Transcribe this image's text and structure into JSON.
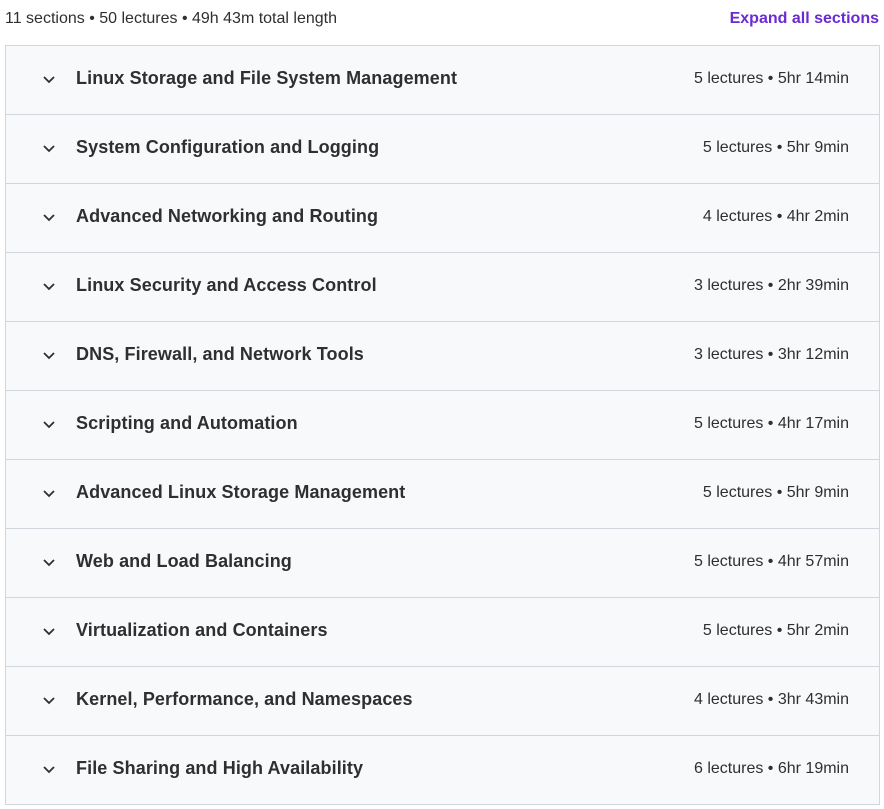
{
  "header": {
    "summary": "11 sections • 50 lectures • 49h 43m total length",
    "expand_label": "Expand all sections"
  },
  "colors": {
    "accent": "#6a2bd3",
    "row_bg": "#f7f9fa",
    "border": "#d1d7dc",
    "text": "#2d2f31"
  },
  "sections": [
    {
      "title": "Linux Storage and File System Management",
      "meta": "5 lectures • 5hr 14min",
      "icon": "chevron-down-icon"
    },
    {
      "title": "System Configuration and Logging",
      "meta": "5 lectures • 5hr 9min",
      "icon": "chevron-down-icon"
    },
    {
      "title": "Advanced Networking and Routing",
      "meta": "4 lectures • 4hr 2min",
      "icon": "chevron-down-icon"
    },
    {
      "title": "Linux Security and Access Control",
      "meta": "3 lectures • 2hr 39min",
      "icon": "chevron-down-icon"
    },
    {
      "title": "DNS, Firewall, and Network Tools",
      "meta": "3 lectures • 3hr 12min",
      "icon": "chevron-down-icon"
    },
    {
      "title": "Scripting and Automation",
      "meta": "5 lectures • 4hr 17min",
      "icon": "chevron-down-icon"
    },
    {
      "title": "Advanced Linux Storage Management",
      "meta": "5 lectures • 5hr 9min",
      "icon": "chevron-down-icon"
    },
    {
      "title": "Web and Load Balancing",
      "meta": "5 lectures • 4hr 57min",
      "icon": "chevron-down-icon"
    },
    {
      "title": "Virtualization and Containers",
      "meta": "5 lectures • 5hr 2min",
      "icon": "chevron-down-icon"
    },
    {
      "title": "Kernel, Performance, and Namespaces",
      "meta": "4 lectures • 3hr 43min",
      "icon": "chevron-down-icon"
    },
    {
      "title": "File Sharing and High Availability",
      "meta": "6 lectures • 6hr 19min",
      "icon": "chevron-down-icon"
    }
  ]
}
